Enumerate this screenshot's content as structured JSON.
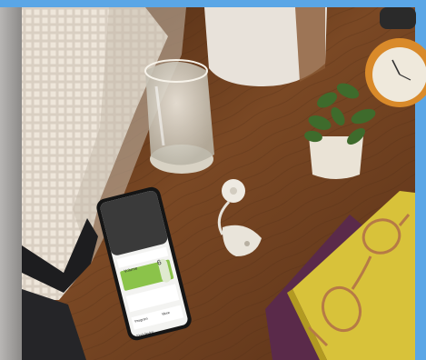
{
  "scene": {
    "description_tags": [
      "bedside-table",
      "smartphone",
      "hearing-processor",
      "glass-of-water",
      "potted-plant",
      "alarm-clock",
      "books",
      "eyeglasses",
      "lamp",
      "pillow"
    ]
  },
  "phone_screen": {
    "volume_label": "Volume",
    "volume_value": "6",
    "tab_program": "Program",
    "tab_more": "More",
    "footer_label": "Find device"
  },
  "colors": {
    "frame_blue": "#5aa6e6",
    "wood": "#6b3f20",
    "screen_green": "#8bc34a"
  }
}
